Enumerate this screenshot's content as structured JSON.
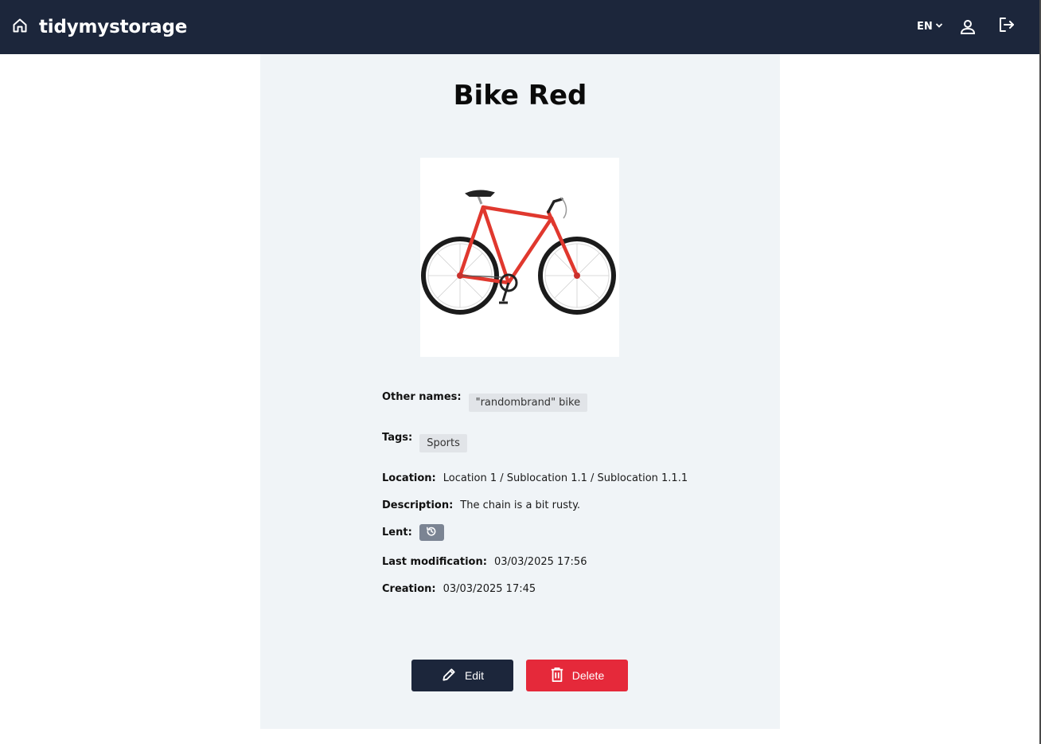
{
  "header": {
    "brand": "tidymystorage",
    "language": "EN",
    "icons": {
      "home": "home-icon",
      "language_caret": "chevron-down-icon",
      "user": "user-icon",
      "logout": "logout-icon"
    },
    "background": "#1c263b"
  },
  "item": {
    "title": "Bike Red",
    "image": "red-bicycle-photo",
    "details": {
      "other_names_label": "Other names:",
      "other_names": [
        "\"randombrand\" bike"
      ],
      "tags_label": "Tags:",
      "tags": [
        "Sports"
      ],
      "location_label": "Location:",
      "location": "Location 1 / Sublocation 1.1 / Sublocation 1.1.1",
      "description_label": "Description:",
      "description": "The chain is a bit rusty.",
      "lent_label": "Lent:",
      "lent_icon": "history-icon",
      "last_modification_label": "Last modification:",
      "last_modification": "03/03/2025 17:56",
      "creation_label": "Creation:",
      "creation": "03/03/2025 17:45"
    }
  },
  "actions": {
    "edit_label": "Edit",
    "edit_icon": "pencil-icon",
    "delete_label": "Delete",
    "delete_icon": "trash-icon",
    "edit_color": "#1c263b",
    "delete_color": "#e5293a"
  }
}
